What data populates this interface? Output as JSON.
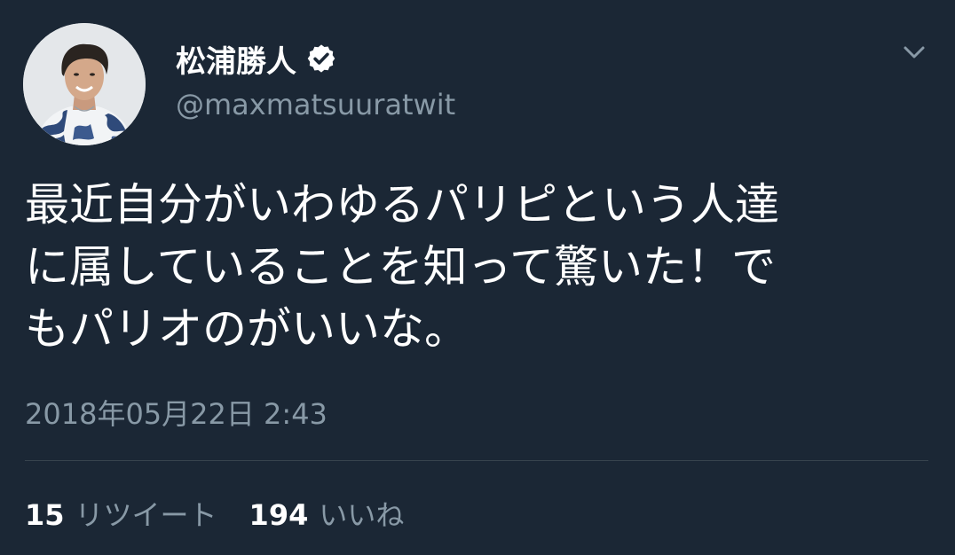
{
  "tweet": {
    "author": {
      "display_name": "松浦勝人",
      "handle": "@maxmatsuuratwit",
      "verified": true,
      "avatar": "profile-photo"
    },
    "text_lines": [
      "最近自分がいわゆるパリピという人達",
      "に属していることを知って驚いた！で",
      "もパリオのがいいな。"
    ],
    "timestamp": "2018年05月22日 2:43",
    "stats": {
      "retweets": {
        "count": "15",
        "label": "リツイート"
      },
      "likes": {
        "count": "194",
        "label": "いいね"
      }
    },
    "menu_icon": "chevron-down-icon"
  },
  "colors": {
    "background": "#1b2735",
    "text_primary": "#ffffff",
    "text_secondary": "#8899a6",
    "divider": "#38444d",
    "verified_badge": "#ffffff"
  }
}
